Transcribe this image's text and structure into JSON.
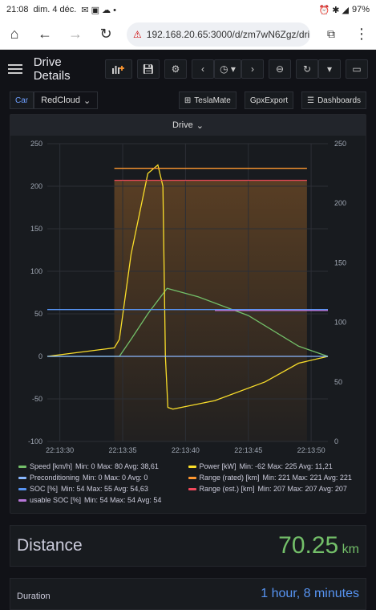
{
  "status": {
    "time": "21:08",
    "date": "dim. 4 déc.",
    "battery": "97%"
  },
  "browser": {
    "url": "192.168.20.65:3000/d/zm7wN6Zgz/dri"
  },
  "header": {
    "title": "Drive Details"
  },
  "vars": {
    "car_label": "Car",
    "car_value": "RedCloud",
    "teslamate": "TeslaMate",
    "gpx": "GpxExport",
    "dashboards": "Dashboards"
  },
  "panel": {
    "title": "Drive"
  },
  "chart_data": {
    "type": "line",
    "title": "Drive",
    "x": [
      "22:13:30",
      "22:13:35",
      "22:13:40",
      "22:13:45",
      "22:13:50"
    ],
    "ylim_left": [
      -100,
      250
    ],
    "yticks_left": [
      "250",
      "200",
      "150",
      "100",
      "50",
      "0",
      "-50",
      "-100"
    ],
    "ylim_right": [
      0,
      250
    ],
    "yticks_right": [
      "250",
      "200",
      "150",
      "100",
      "50",
      "0"
    ],
    "series": [
      {
        "name": "Speed [km/h]",
        "color": "#73bf69",
        "stats": "Min: 0  Max: 80  Avg: 38,61",
        "t": [
          0,
          8.6,
          10,
          12,
          14.3,
          18,
          24,
          30,
          33.5
        ],
        "values": [
          0,
          0,
          20,
          50,
          80,
          70,
          48,
          12,
          0
        ]
      },
      {
        "name": "Power [kW]",
        "color": "#fade2a",
        "stats": "Min: -62  Max: 225  Avg: 11,21",
        "t": [
          0,
          8,
          8.6,
          10,
          12,
          13.2,
          13.8,
          14.1,
          14.4,
          15,
          20,
          26,
          30,
          33.5
        ],
        "values": [
          0,
          10,
          20,
          120,
          215,
          225,
          200,
          0,
          -60,
          -62,
          -52,
          -30,
          -8,
          0
        ]
      },
      {
        "name": "Preconditioning",
        "color": "#8ab8ff",
        "stats": "Min: 0  Max: 0  Avg: 0",
        "t": [
          0,
          33.5
        ],
        "values": [
          0,
          0
        ]
      },
      {
        "name": "Range (rated) [km]",
        "color": "#ff9830",
        "stats": "Min: 221  Max: 221  Avg: 221",
        "t": [
          8,
          31
        ],
        "values": [
          221,
          221
        ]
      },
      {
        "name": "SOC [%]",
        "color": "#5794f2",
        "stats": "Min: 54  Max: 55  Avg: 54,63",
        "t": [
          0,
          33.5
        ],
        "values": [
          55,
          55
        ]
      },
      {
        "name": "Range (est.) [km]",
        "color": "#f2495c",
        "stats": "Min: 207  Max: 207  Avg: 207",
        "t": [
          8,
          31
        ],
        "values": [
          207,
          207
        ]
      },
      {
        "name": "usable SOC [%]",
        "color": "#b877d9",
        "stats": "Min: 54  Max: 54  Avg: 54",
        "t": [
          20,
          33.5
        ],
        "values": [
          54,
          54
        ]
      }
    ]
  },
  "distance": {
    "label": "Distance",
    "value": "70.25",
    "unit": "km"
  },
  "duration": {
    "label": "Duration",
    "value": "1 hour, 8 minutes"
  }
}
